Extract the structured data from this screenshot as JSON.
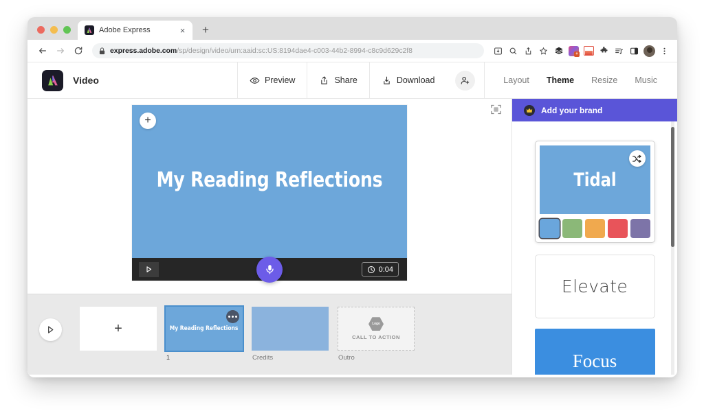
{
  "browser": {
    "tab": {
      "title": "Adobe Express",
      "favicon": "adobe-express-favicon",
      "close": "×"
    },
    "newtab_label": "+",
    "url_secure_prefix": "express.adobe.com",
    "url_path": "/sp/design/video/urn:aaid:sc:US:8194dae4-c003-44b2-8994-c8c9d629c2f8",
    "toolbar_icons": [
      "install-icon",
      "search-icon",
      "share-icon",
      "bookmark-star-icon",
      "layers-extension-icon",
      "color-extension-icon",
      "reading-extension-icon",
      "puzzle-extension-icon",
      "list-extension-icon",
      "sidepanel-icon",
      "profile-avatar",
      "more-menu-icon"
    ]
  },
  "app": {
    "logo": "adobe-express-logo",
    "doc_type": "Video",
    "actions": [
      {
        "label": "Preview",
        "icon": "eye-icon"
      },
      {
        "label": "Share",
        "icon": "share-up-icon"
      },
      {
        "label": "Download",
        "icon": "download-icon"
      }
    ],
    "invite_icon": "add-person-icon",
    "tabs": [
      {
        "label": "Layout",
        "active": false
      },
      {
        "label": "Theme",
        "active": true
      },
      {
        "label": "Resize",
        "active": false
      },
      {
        "label": "Music",
        "active": false
      }
    ]
  },
  "stage": {
    "fit_icon": "fit-to-screen-icon",
    "canvas": {
      "add_icon": "+",
      "title": "My Reading Reflections",
      "background_color": "#6da7da",
      "play_icon": "play-icon",
      "mic_icon": "microphone-icon",
      "mic_color": "#6c5ce8",
      "timer_icon": "clock-icon",
      "timer_value": "0:04"
    }
  },
  "timeline": {
    "play_icon": "play-icon",
    "items": [
      {
        "type": "add",
        "symbol": "+",
        "label": "",
        "name": "add-slide-card"
      },
      {
        "type": "slide",
        "thumb_text": "My Reading Reflections",
        "label": "1",
        "selected": true,
        "menu_icon": "more-dots-icon",
        "name": "slide-1-card"
      },
      {
        "type": "credits",
        "thumb_text": "",
        "label": "Credits",
        "selected": false,
        "name": "credits-card"
      },
      {
        "type": "outro",
        "thumb_text": "CALL TO ACTION",
        "badge": "Logo",
        "label": "Outro",
        "selected": false,
        "name": "outro-card"
      }
    ]
  },
  "panel": {
    "banner": {
      "label": "Add your brand",
      "icon": "crown-icon",
      "color": "#5a55d8"
    },
    "themes": [
      {
        "name": "Tidal",
        "style": "selected",
        "preview_bg": "#6da7da",
        "shuffle_icon": "shuffle-icon",
        "swatches": [
          "#6aa6dc",
          "#8bb878",
          "#f0a94e",
          "#e8545a",
          "#7d74a8"
        ],
        "active_swatch_index": 0
      },
      {
        "name": "Elevate",
        "style": "plain",
        "preview_bg": "#ffffff"
      },
      {
        "name": "Focus",
        "style": "filled",
        "preview_bg": "#3b8ee0"
      }
    ]
  }
}
